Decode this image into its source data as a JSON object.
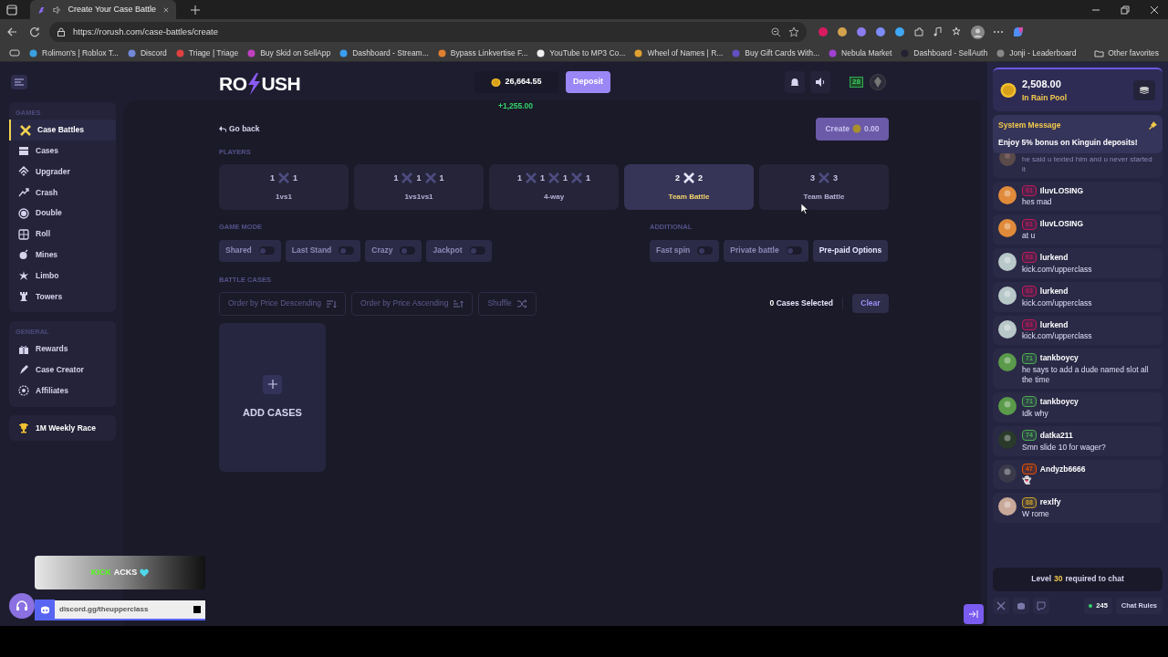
{
  "browser": {
    "tab_title": "Create Your Case Battle",
    "url": "https://rorush.com/case-battles/create",
    "bookmarks": [
      "Rolimon's | Roblox T...",
      "Discord",
      "Triage | Triage",
      "Buy Skid on SellApp",
      "Dashboard - Stream...",
      "Bypass Linkvertise F...",
      "YouTube to MP3 Co...",
      "Wheel of Names | R...",
      "Buy Gift Cards With...",
      "Nebula Market",
      "Dashboard - SellAuth",
      "Jonji - Leaderboard"
    ],
    "other_favorites": "Other favorites"
  },
  "header": {
    "logo_left": "RO",
    "logo_right": "USH",
    "balance": "26,664.55",
    "deposit": "Deposit",
    "gain": "+1,255.00",
    "level": "28"
  },
  "sidebar": {
    "sections": [
      {
        "title": "GAMES",
        "items": [
          {
            "label": "Case Battles",
            "selected": true
          },
          {
            "label": "Cases",
            "selected": false
          },
          {
            "label": "Upgrader",
            "selected": false
          },
          {
            "label": "Crash",
            "selected": false
          },
          {
            "label": "Double",
            "selected": false
          },
          {
            "label": "Roll",
            "selected": false
          },
          {
            "label": "Mines",
            "selected": false
          },
          {
            "label": "Limbo",
            "selected": false
          },
          {
            "label": "Towers",
            "selected": false
          }
        ]
      },
      {
        "title": "GENERAL",
        "items": [
          {
            "label": "Rewards",
            "selected": false
          },
          {
            "label": "Case Creator",
            "selected": false
          },
          {
            "label": "Affiliates",
            "selected": false
          }
        ]
      }
    ],
    "race": "1M Weekly Race"
  },
  "main": {
    "go_back": "Go back",
    "create": "Create",
    "create_amount": "0.00",
    "players_label": "PLAYERS",
    "players": [
      {
        "numbers": [
          "1",
          "1"
        ],
        "label": "1vs1",
        "selected": false
      },
      {
        "numbers": [
          "1",
          "1",
          "1"
        ],
        "label": "1vs1vs1",
        "selected": false
      },
      {
        "numbers": [
          "1",
          "1",
          "1",
          "1"
        ],
        "label": "4-way",
        "selected": false
      },
      {
        "numbers": [
          "2",
          "2"
        ],
        "label": "Team Battle",
        "selected": true
      },
      {
        "numbers": [
          "3",
          "3"
        ],
        "label": "Team Battle",
        "selected": false
      }
    ],
    "game_mode_label": "GAME MODE",
    "modes": [
      {
        "label": "Shared",
        "on": false
      },
      {
        "label": "Last Stand",
        "on": false
      },
      {
        "label": "Crazy",
        "on": false
      },
      {
        "label": "Jackpot",
        "on": false
      }
    ],
    "additional_label": "ADDITIONAL",
    "additional": [
      {
        "kind": "toggle",
        "label": "Fast spin",
        "on": false
      },
      {
        "kind": "toggle",
        "label": "Private battle",
        "on": false
      },
      {
        "kind": "button",
        "label": "Pre-paid Options"
      }
    ],
    "battle_cases_label": "BATTLE CASES",
    "sorts": [
      {
        "kind": "desc",
        "label": "Order by Price Descending"
      },
      {
        "kind": "asc",
        "label": "Order by Price Ascending"
      },
      {
        "kind": "shuffle",
        "label": "Shuffle"
      }
    ],
    "cases_count": "0",
    "cases_selected": "Cases Selected",
    "clear": "Clear",
    "add_cases": "ADD CASES"
  },
  "chat": {
    "rain_amount": "2,508.00",
    "rain_label": "In Rain Pool",
    "system_title": "System Message",
    "system_text": "Enjoy 5% bonus on Kinguin deposits!",
    "partial_text": "he said u texted him and u never started it",
    "messages": [
      {
        "user": "IluvLOSING",
        "level": "61",
        "color": "#c2185b",
        "text": "hes mad"
      },
      {
        "user": "IluvLOSING",
        "level": "61",
        "color": "#c2185b",
        "text": "at u"
      },
      {
        "user": "lurkend",
        "level": "63",
        "color": "#c2185b",
        "text": "kick.com/upperclass"
      },
      {
        "user": "lurkend",
        "level": "63",
        "color": "#c2185b",
        "text": "kick.com/upperclass"
      },
      {
        "user": "lurkend",
        "level": "63",
        "color": "#c2185b",
        "text": "kick.com/upperclass"
      },
      {
        "user": "tankboycy",
        "level": "71",
        "color": "#4caf50",
        "text": "he says to add a dude named slot all the time"
      },
      {
        "user": "tankboycy",
        "level": "71",
        "color": "#4caf50",
        "text": "Idk why"
      },
      {
        "user": "datka211",
        "level": "74",
        "color": "#4caf50",
        "text": "Smn slide 10 for wager?"
      },
      {
        "user": "Andyzb6666",
        "level": "47",
        "color": "#e65100",
        "text": "👻"
      },
      {
        "user": "rexlfy",
        "level": "88",
        "color": "#c9a227",
        "text": "W rome"
      }
    ],
    "level_prefix": "Level",
    "level_value": "30",
    "level_suffix": "required to chat",
    "online": "245",
    "rules": "Chat Rules"
  },
  "overlay": {
    "kick_green": "KICK",
    "kick_white": "ACKS",
    "discord": "discord.gg/theupperclass"
  }
}
